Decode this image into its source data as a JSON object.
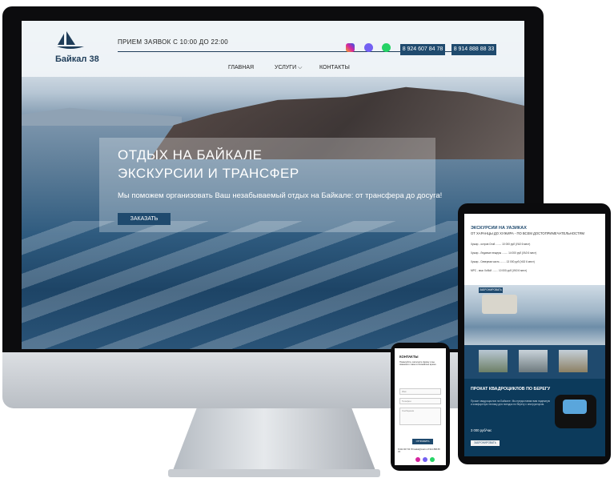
{
  "desktop": {
    "logo_text": "Байкал 38",
    "hours": "ПРИЕМ ЗАЯВОК С 10:00 ДО 22:00",
    "phones": [
      "8 924 607 84 78",
      "8 914 888 88 33"
    ],
    "nav": {
      "home": "ГЛАВНАЯ",
      "services": "УСЛУГИ ⌵",
      "contacts": "КОНТАКТЫ"
    },
    "hero": {
      "line1": "ОТДЫХ НА БАЙКАЛЕ",
      "line2": "ЭКСКУРСИИ И ТРАНСФЕР",
      "subtitle": "Мы поможем организовать Ваш незабываемый отдых на Байкале: от трансфера до досуга!",
      "button": "ЗАКАЗАТЬ"
    }
  },
  "tablet": {
    "title": "ЭКСКУРСИИ НА УАЗИКАХ",
    "subtitle": "ОТ ХАРАНЦЫ ДО ХУЖИРА - ПО ВСЕМ ДОСТОПРИМЕЧАТЕЛЬНОСТЯМ",
    "rows": [
      "Хужир - остров Огой ........ 10 000 руб (УАЗ 6 мест)",
      "Хужир - Ледяные пещеры ........ 14 000 руб (УАЗ 6 мест)",
      "Хужир - Северная часть ........ 13 000 руб (УАЗ 6 мест)",
      "МРС - мыс Хобой ........ 10 000 руб (УАЗ 6 мест)"
    ],
    "book_button": "ЗАБРОНИРОВАТЬ",
    "quad_title": "ПРОКАТ КВАДРОЦИКЛОВ ПО БЕРЕГУ",
    "quad_text": "Прокат квадроциклов на Байкале. Мы предоставим вам надежную и комфортную технику для поездок по берегу с инструктором.",
    "price": "3 000 руб/час",
    "quad_button": "ЗАБРОНИРОВАТЬ"
  },
  "phone": {
    "title": "КОНТАКТЫ",
    "text": "Пожалуйста, заполните форму и мы свяжемся с вами в ближайшее время.",
    "name_placeholder": "Имя",
    "phone_placeholder": "Телефон",
    "message_placeholder": "Сообщение",
    "send_button": "ОТПРАВИТЬ",
    "footer": "8 924 607 84 78   baikal@mail.ru   8 914 888 88 33"
  }
}
